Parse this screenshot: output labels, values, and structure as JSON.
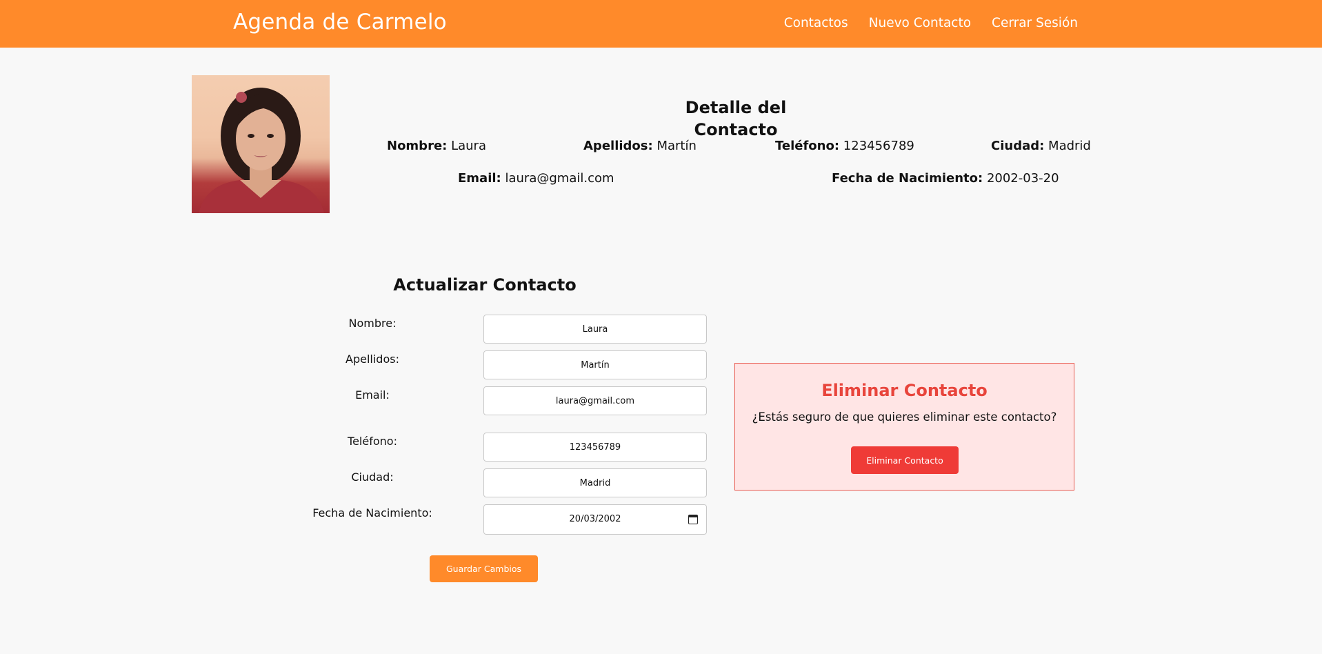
{
  "header": {
    "brand": "Agenda de Carmelo",
    "nav": [
      "Contactos",
      "Nuevo Contacto",
      "Cerrar Sesión"
    ]
  },
  "detail": {
    "title": "Detalle del Contacto",
    "fields": [
      {
        "label": "Nombre:",
        "value": "Laura"
      },
      {
        "label": "Apellidos:",
        "value": "Martín"
      },
      {
        "label": "Teléfono:",
        "value": "123456789"
      },
      {
        "label": "Ciudad:",
        "value": "Madrid"
      },
      {
        "label": "Email:",
        "value": "laura@gmail.com"
      },
      {
        "label": "Fecha de Nacimiento:",
        "value": "2002-03-20"
      }
    ]
  },
  "update_form": {
    "title": "Actualizar Contacto",
    "fields": [
      {
        "label": "Nombre:",
        "value": "Laura"
      },
      {
        "label": "Apellidos:",
        "value": "Martín"
      },
      {
        "label": "Email:",
        "value": "laura@gmail.com"
      },
      {
        "label": "Teléfono:",
        "value": "123456789"
      },
      {
        "label": "Ciudad:",
        "value": "Madrid"
      },
      {
        "label": "Fecha de Nacimiento:",
        "value": "20/03/2002"
      }
    ],
    "save_label": "Guardar Cambios"
  },
  "delete_panel": {
    "title": "Eliminar Contacto",
    "message": "¿Estás seguro de que quieres eliminar este contacto?",
    "button_label": "Eliminar Contacto"
  },
  "colors": {
    "header_bg": "#ff8a2a",
    "delete_accent": "#ef3b37",
    "delete_panel_bg": "#ffe5e5",
    "page_bg": "#f8f8f8"
  },
  "icons": {
    "calendar": "calendar-icon"
  }
}
